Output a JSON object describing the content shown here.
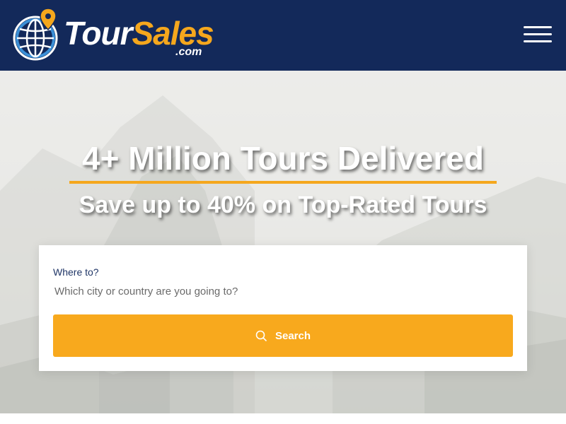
{
  "header": {
    "logo": {
      "word_part1": "Tour",
      "word_part2": "Sales",
      "domain_suffix": ".com",
      "icon": "globe-pin-icon"
    },
    "menu_icon": "hamburger-menu-icon",
    "background_color": "#13295a"
  },
  "hero": {
    "title": "4+ Million Tours Delivered",
    "subtitle": "Save up to 40% on Top-Rated Tours",
    "accent_color": "#f5a71d"
  },
  "search": {
    "label": "Where to?",
    "placeholder": "Which city or country are you going to?",
    "value": "",
    "button_label": "Search",
    "button_icon": "search-icon",
    "button_color": "#f8a91d"
  }
}
